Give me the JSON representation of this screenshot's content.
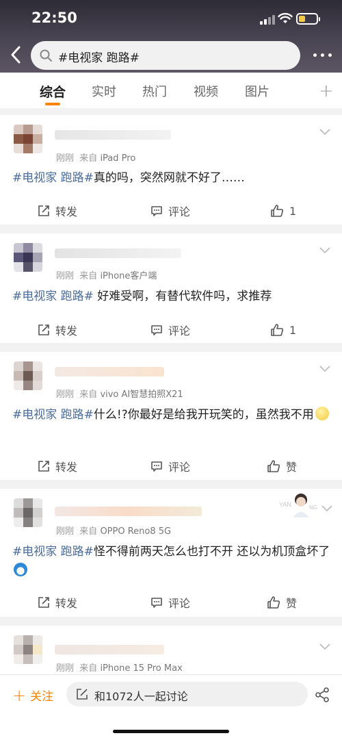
{
  "status": {
    "time": "22:50"
  },
  "search": {
    "query": "#电视家 跑路#"
  },
  "tabs": [
    {
      "label": "综合"
    },
    {
      "label": "实时"
    },
    {
      "label": "热门"
    },
    {
      "label": "视频"
    },
    {
      "label": "图片"
    }
  ],
  "posts": [
    {
      "meta_time": "刚刚",
      "meta_from": "来自",
      "source": "iPad Pro",
      "tag": "#电视家 跑路#",
      "body": "真的吗，突然网就不好了……",
      "repost": "转发",
      "comment": "评论",
      "like": "1"
    },
    {
      "meta_time": "刚刚",
      "meta_from": "来自",
      "source": "iPhone客户端",
      "tag": "#电视家 跑路#",
      "body": " 好难受啊，有替代软件吗，求推荐",
      "repost": "转发",
      "comment": "评论",
      "like": "1"
    },
    {
      "meta_time": "刚刚",
      "meta_from": "来自",
      "source": "vivo AI智慧拍照X21",
      "tag": "#电视家 跑路#",
      "body": "什么!?你最好是给我开玩笑的，虽然我不用",
      "repost": "转发",
      "comment": "评论",
      "like": "赞"
    },
    {
      "meta_time": "刚刚",
      "meta_from": "来自",
      "source": "OPPO Reno8 5G",
      "tag": "#电视家 跑路#",
      "body": "怪不得前两天怎么也打不开 还以为机顶盒坏了",
      "repost": "转发",
      "comment": "评论",
      "like": "赞"
    },
    {
      "meta_time": "刚刚",
      "meta_from": "来自",
      "source": "iPhone 15 Pro Max"
    }
  ],
  "bottom": {
    "follow": "关注",
    "discuss": "和1072人一起讨论"
  },
  "colors": {
    "accent": "#ff8200",
    "tag": "#4a6b9a"
  }
}
